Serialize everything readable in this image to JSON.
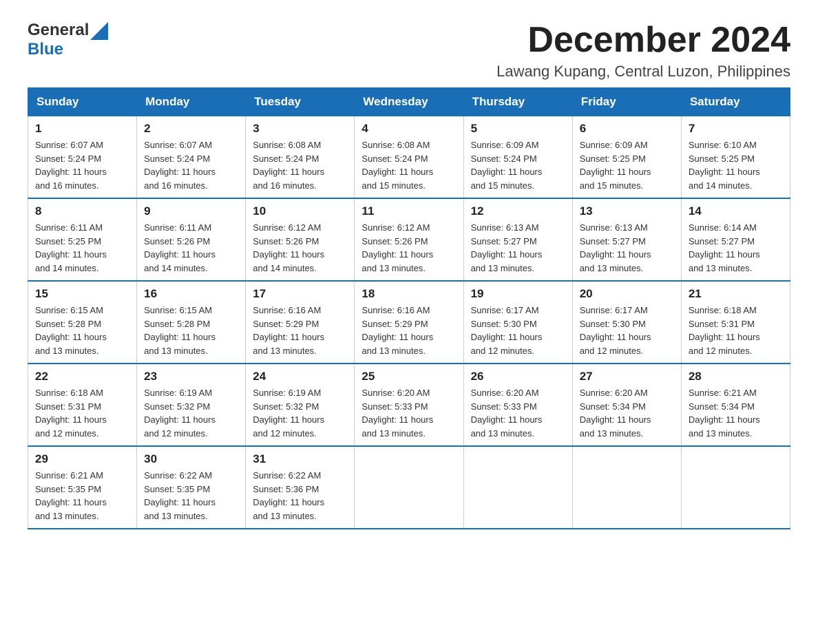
{
  "header": {
    "logo_general": "General",
    "logo_blue": "Blue",
    "title": "December 2024",
    "subtitle": "Lawang Kupang, Central Luzon, Philippines"
  },
  "weekdays": [
    "Sunday",
    "Monday",
    "Tuesday",
    "Wednesday",
    "Thursday",
    "Friday",
    "Saturday"
  ],
  "weeks": [
    [
      {
        "day": "1",
        "sunrise": "6:07 AM",
        "sunset": "5:24 PM",
        "daylight": "11 hours and 16 minutes."
      },
      {
        "day": "2",
        "sunrise": "6:07 AM",
        "sunset": "5:24 PM",
        "daylight": "11 hours and 16 minutes."
      },
      {
        "day": "3",
        "sunrise": "6:08 AM",
        "sunset": "5:24 PM",
        "daylight": "11 hours and 16 minutes."
      },
      {
        "day": "4",
        "sunrise": "6:08 AM",
        "sunset": "5:24 PM",
        "daylight": "11 hours and 15 minutes."
      },
      {
        "day": "5",
        "sunrise": "6:09 AM",
        "sunset": "5:24 PM",
        "daylight": "11 hours and 15 minutes."
      },
      {
        "day": "6",
        "sunrise": "6:09 AM",
        "sunset": "5:25 PM",
        "daylight": "11 hours and 15 minutes."
      },
      {
        "day": "7",
        "sunrise": "6:10 AM",
        "sunset": "5:25 PM",
        "daylight": "11 hours and 14 minutes."
      }
    ],
    [
      {
        "day": "8",
        "sunrise": "6:11 AM",
        "sunset": "5:25 PM",
        "daylight": "11 hours and 14 minutes."
      },
      {
        "day": "9",
        "sunrise": "6:11 AM",
        "sunset": "5:26 PM",
        "daylight": "11 hours and 14 minutes."
      },
      {
        "day": "10",
        "sunrise": "6:12 AM",
        "sunset": "5:26 PM",
        "daylight": "11 hours and 14 minutes."
      },
      {
        "day": "11",
        "sunrise": "6:12 AM",
        "sunset": "5:26 PM",
        "daylight": "11 hours and 13 minutes."
      },
      {
        "day": "12",
        "sunrise": "6:13 AM",
        "sunset": "5:27 PM",
        "daylight": "11 hours and 13 minutes."
      },
      {
        "day": "13",
        "sunrise": "6:13 AM",
        "sunset": "5:27 PM",
        "daylight": "11 hours and 13 minutes."
      },
      {
        "day": "14",
        "sunrise": "6:14 AM",
        "sunset": "5:27 PM",
        "daylight": "11 hours and 13 minutes."
      }
    ],
    [
      {
        "day": "15",
        "sunrise": "6:15 AM",
        "sunset": "5:28 PM",
        "daylight": "11 hours and 13 minutes."
      },
      {
        "day": "16",
        "sunrise": "6:15 AM",
        "sunset": "5:28 PM",
        "daylight": "11 hours and 13 minutes."
      },
      {
        "day": "17",
        "sunrise": "6:16 AM",
        "sunset": "5:29 PM",
        "daylight": "11 hours and 13 minutes."
      },
      {
        "day": "18",
        "sunrise": "6:16 AM",
        "sunset": "5:29 PM",
        "daylight": "11 hours and 13 minutes."
      },
      {
        "day": "19",
        "sunrise": "6:17 AM",
        "sunset": "5:30 PM",
        "daylight": "11 hours and 12 minutes."
      },
      {
        "day": "20",
        "sunrise": "6:17 AM",
        "sunset": "5:30 PM",
        "daylight": "11 hours and 12 minutes."
      },
      {
        "day": "21",
        "sunrise": "6:18 AM",
        "sunset": "5:31 PM",
        "daylight": "11 hours and 12 minutes."
      }
    ],
    [
      {
        "day": "22",
        "sunrise": "6:18 AM",
        "sunset": "5:31 PM",
        "daylight": "11 hours and 12 minutes."
      },
      {
        "day": "23",
        "sunrise": "6:19 AM",
        "sunset": "5:32 PM",
        "daylight": "11 hours and 12 minutes."
      },
      {
        "day": "24",
        "sunrise": "6:19 AM",
        "sunset": "5:32 PM",
        "daylight": "11 hours and 12 minutes."
      },
      {
        "day": "25",
        "sunrise": "6:20 AM",
        "sunset": "5:33 PM",
        "daylight": "11 hours and 13 minutes."
      },
      {
        "day": "26",
        "sunrise": "6:20 AM",
        "sunset": "5:33 PM",
        "daylight": "11 hours and 13 minutes."
      },
      {
        "day": "27",
        "sunrise": "6:20 AM",
        "sunset": "5:34 PM",
        "daylight": "11 hours and 13 minutes."
      },
      {
        "day": "28",
        "sunrise": "6:21 AM",
        "sunset": "5:34 PM",
        "daylight": "11 hours and 13 minutes."
      }
    ],
    [
      {
        "day": "29",
        "sunrise": "6:21 AM",
        "sunset": "5:35 PM",
        "daylight": "11 hours and 13 minutes."
      },
      {
        "day": "30",
        "sunrise": "6:22 AM",
        "sunset": "5:35 PM",
        "daylight": "11 hours and 13 minutes."
      },
      {
        "day": "31",
        "sunrise": "6:22 AM",
        "sunset": "5:36 PM",
        "daylight": "11 hours and 13 minutes."
      },
      null,
      null,
      null,
      null
    ]
  ],
  "labels": {
    "sunrise": "Sunrise:",
    "sunset": "Sunset:",
    "daylight": "Daylight:"
  },
  "colors": {
    "header_bg": "#1a6eb5",
    "header_text": "#ffffff",
    "border": "#cccccc",
    "accent": "#1a6eb5"
  }
}
